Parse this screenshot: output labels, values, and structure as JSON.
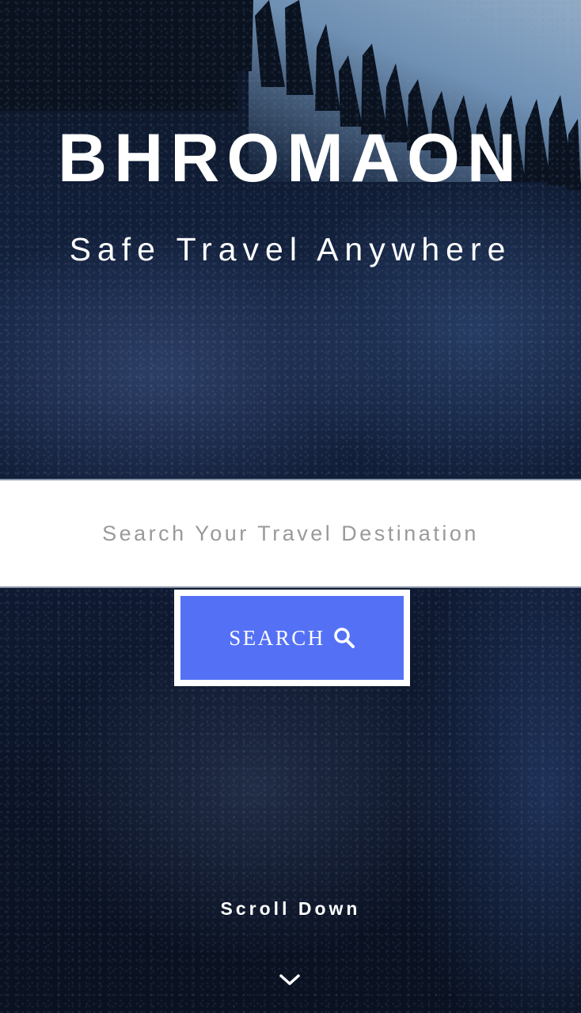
{
  "hero": {
    "title": "BHROMAON",
    "tagline": "Safe Travel Anywhere",
    "background_icon": "forest-rock-photo"
  },
  "search": {
    "placeholder": "Search Your Travel Destination",
    "value": "",
    "button_label": "SEARCH",
    "button_icon": "search-icon",
    "button_color": "#5471f5"
  },
  "footer": {
    "scroll_label": "Scroll Down",
    "scroll_icon": "chevron-down-icon"
  }
}
